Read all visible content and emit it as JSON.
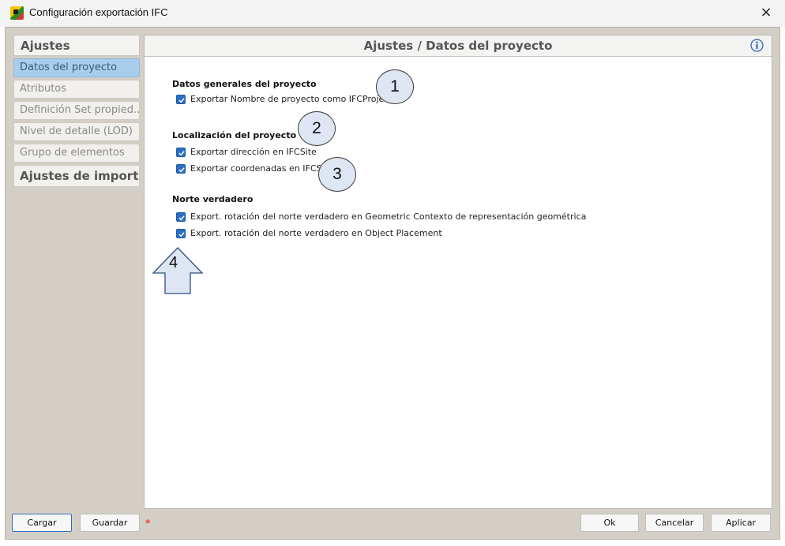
{
  "window": {
    "title": "Configuración exportación IFC",
    "close_label": "×"
  },
  "sidebar": {
    "header": "Ajustes",
    "items": [
      {
        "label": "Datos del proyecto"
      },
      {
        "label": "Atributos"
      },
      {
        "label": "Definición Set propied..."
      },
      {
        "label": "Nivel de detalle (LOD)"
      },
      {
        "label": "Grupo de elementos"
      },
      {
        "label": "Ajustes de import..."
      }
    ],
    "active_index": 0
  },
  "panel": {
    "title": "Ajustes / Datos del proyecto",
    "info_icon": "info-icon",
    "sections": [
      {
        "title": "Datos generales del proyecto",
        "options": [
          {
            "label": "Exportar Nombre de proyecto como IFCProject",
            "checked": true
          }
        ]
      },
      {
        "title": "Localización del proyecto",
        "options": [
          {
            "label": "Exportar dirección en IFCSite",
            "checked": true
          },
          {
            "label": "Exportar coordenadas en IFCSite",
            "checked": true
          }
        ]
      },
      {
        "title": "Norte verdadero",
        "options": [
          {
            "label": "Export. rotación del norte verdadero en Geometric Contexto de representación geométrica",
            "checked": true
          },
          {
            "label": "Export. rotación del norte verdadero en Object Placement",
            "checked": true
          }
        ]
      }
    ]
  },
  "annotations": {
    "callouts": [
      "1",
      "2",
      "3"
    ],
    "arrow_label": "4"
  },
  "footer": {
    "load_label": "Cargar",
    "save_label": "Guardar",
    "dirty_marker": "*",
    "ok_label": "Ok",
    "cancel_label": "Cancelar",
    "apply_label": "Aplicar"
  },
  "colors": {
    "accent": "#2b6fc6",
    "active_nav": "#a9cdec",
    "dialog_bg": "#d4cfc6",
    "callout_fill": "#dde6f2"
  }
}
